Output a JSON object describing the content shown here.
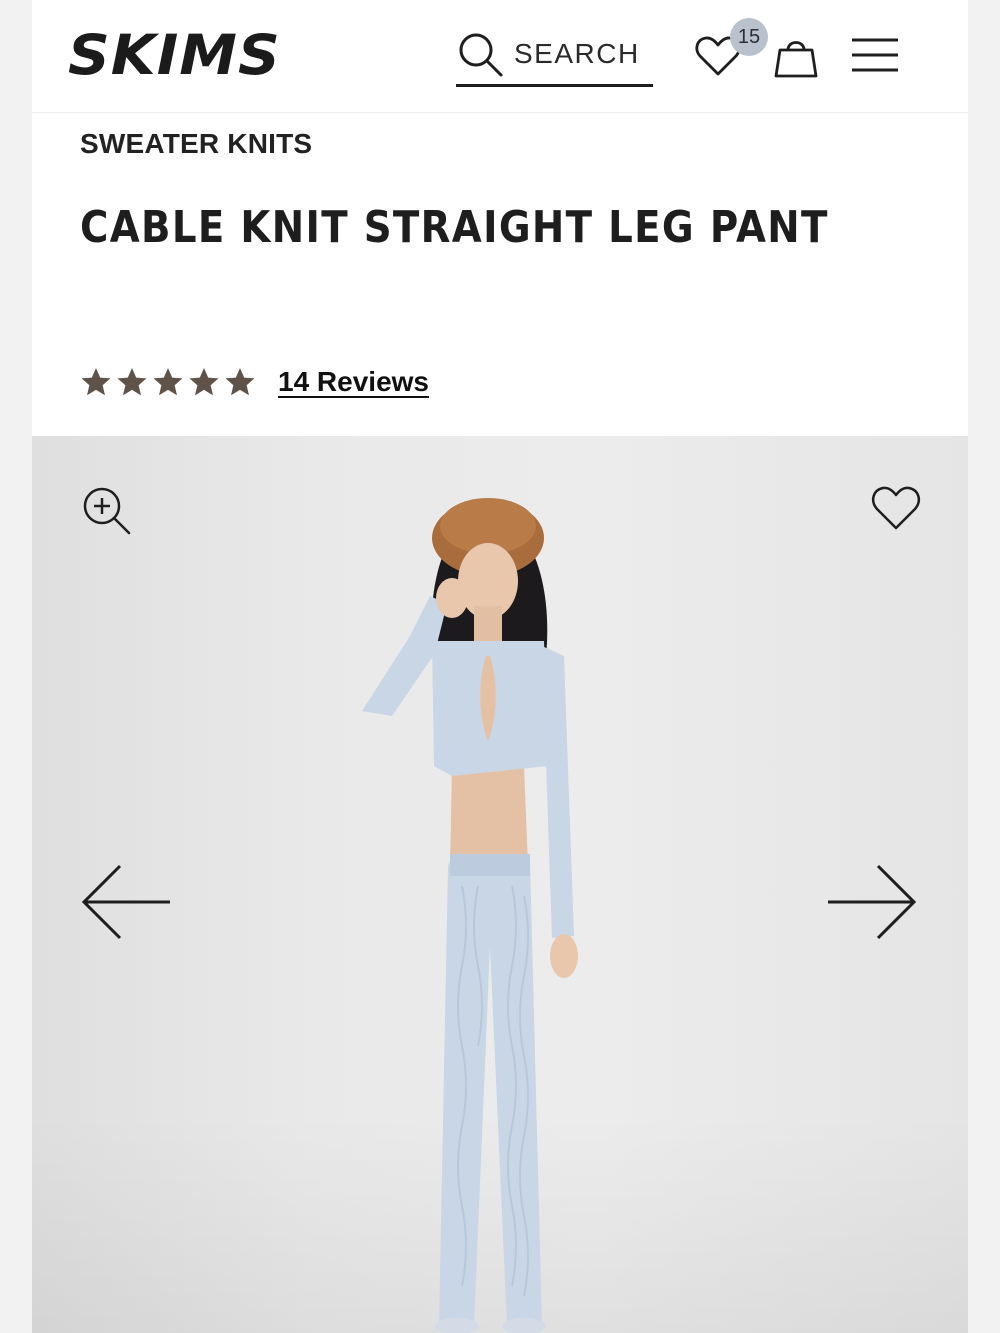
{
  "header": {
    "logo": "SKIMS",
    "search_label": "SEARCH",
    "wishlist_count": "15"
  },
  "product": {
    "category": "SWEATER KNITS",
    "title": "CABLE KNIT STRAIGHT LEG PANT",
    "rating": 5,
    "rating_max": 5,
    "reviews_label": "14 Reviews"
  },
  "colors": {
    "text": "#1e1e1e",
    "star": "#5e5249",
    "badge": "#b9c1cd",
    "knit": "#c9d6e6",
    "hat": "#a86c3d"
  },
  "icons": [
    "search-icon",
    "heart-icon",
    "bag-icon",
    "menu-icon",
    "star-icon",
    "zoom-in-icon",
    "arrow-left-icon",
    "arrow-right-icon"
  ]
}
